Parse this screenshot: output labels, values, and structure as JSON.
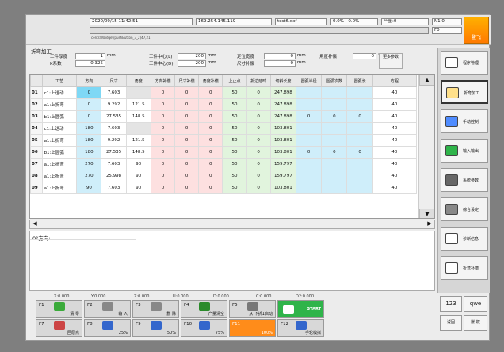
{
  "header": {
    "datetime": "2020/09/15 11:42:51",
    "ip": "169.254.145.119",
    "file": "test6.dxf",
    "progress": "0.0% : 0.0%",
    "count": "产量:0",
    "mode": "N1.0",
    "flag": "F0",
    "path": "centralWidget/pushButton_3_2(47,21)",
    "logo_label": "鳌飞"
  },
  "title": "折弯加工",
  "params": [
    {
      "label": "工件厚度",
      "value": "1",
      "unit": "mm"
    },
    {
      "label": "K系数",
      "value": "0.325",
      "unit": ""
    },
    {
      "label": "工件中心(L)",
      "value": "200",
      "unit": "mm"
    },
    {
      "label": "工件中心(D)",
      "value": "200",
      "unit": "mm"
    },
    {
      "label": "定位宽度",
      "value": "0",
      "unit": "mm"
    },
    {
      "label": "尺寸补偿",
      "value": "0",
      "unit": "mm"
    },
    {
      "label": "角度补偿",
      "value": "0",
      "unit": "°"
    },
    {
      "label": "更多参数",
      "value": "",
      "unit": ""
    }
  ],
  "table": {
    "headers": [
      "工艺",
      "方向",
      "尺寸",
      "角度",
      "方向补偿",
      "尺寸补偿",
      "角度补偿",
      "上止点",
      "折边延时",
      "切斜长度",
      "圆弧半径",
      "圆弧次数",
      "圆弧长",
      "方程"
    ],
    "rows": [
      [
        "01",
        "c1:上送动",
        "0",
        "7.603",
        "",
        "0",
        "0",
        "0",
        "50",
        "0",
        "247.898",
        "",
        "",
        "",
        "40"
      ],
      [
        "02",
        "a1:上折弯",
        "0",
        "9.292",
        "121.5",
        "0",
        "0",
        "0",
        "50",
        "0",
        "247.898",
        "",
        "",
        "",
        "40"
      ],
      [
        "03",
        "b1:上圆弧",
        "0",
        "27.535",
        "148.5",
        "0",
        "0",
        "0",
        "50",
        "0",
        "247.898",
        "0",
        "0",
        "0",
        "40"
      ],
      [
        "04",
        "c1:上送动",
        "180",
        "7.603",
        "",
        "0",
        "0",
        "0",
        "50",
        "0",
        "103.801",
        "",
        "",
        "",
        "40"
      ],
      [
        "05",
        "a1:上折弯",
        "180",
        "9.292",
        "121.5",
        "0",
        "0",
        "0",
        "50",
        "0",
        "103.801",
        "",
        "",
        "",
        "40"
      ],
      [
        "06",
        "b1:上圆弧",
        "180",
        "27.535",
        "148.5",
        "0",
        "0",
        "0",
        "50",
        "0",
        "103.801",
        "0",
        "0",
        "0",
        "40"
      ],
      [
        "07",
        "a1:上折弯",
        "270",
        "7.603",
        "90",
        "0",
        "0",
        "0",
        "50",
        "0",
        "159.797",
        "",
        "",
        "",
        "40"
      ],
      [
        "08",
        "a1:上折弯",
        "270",
        "25.998",
        "90",
        "0",
        "0",
        "0",
        "50",
        "0",
        "159.797",
        "",
        "",
        "",
        "40"
      ],
      [
        "09",
        "a1:上折弯",
        "90",
        "7.603",
        "90",
        "0",
        "0",
        "0",
        "50",
        "0",
        "103.801",
        "",
        "",
        "",
        "40"
      ]
    ]
  },
  "memo": "0°方向:",
  "coords": [
    "X:0.000",
    "Y:0.000",
    "Z:0.000",
    "U:0.000",
    "D:0.000",
    "C:0.000",
    "D2:0.000"
  ],
  "fkeys": [
    {
      "n": "F1",
      "label": "清 零",
      "color": "#3aaa3a"
    },
    {
      "n": "F2",
      "label": "输 入",
      "color": "#888"
    },
    {
      "n": "F3",
      "label": "删 除",
      "color": "#888"
    },
    {
      "n": "F4",
      "label": "产量清空",
      "color": "#2a8a2a"
    },
    {
      "n": "F5",
      "label": "从 下折1启动",
      "color": "#777"
    },
    {
      "n": "START",
      "label": "START",
      "color": "#2fb44a"
    },
    {
      "n": "F7",
      "label": "回原点",
      "color": "#cc4444"
    },
    {
      "n": "F8",
      "label": "25%",
      "color": "#3366cc"
    },
    {
      "n": "F9",
      "label": "50%",
      "color": "#3366cc"
    },
    {
      "n": "F10",
      "label": "75%",
      "color": "#3366cc"
    },
    {
      "n": "F11",
      "label": "100%",
      "color": "#ff8c1a"
    },
    {
      "n": "F12",
      "label": "手轮模拟",
      "color": "#3366cc"
    }
  ],
  "side": [
    "程序管理",
    "折弯加工",
    "手动控制",
    "输入输出",
    "系统参数",
    "综合设定",
    "诊断信息",
    "折弯补偿"
  ],
  "bottom": {
    "num": "123",
    "qwe": "qwe",
    "back": "返回",
    "auth": "账 权"
  }
}
